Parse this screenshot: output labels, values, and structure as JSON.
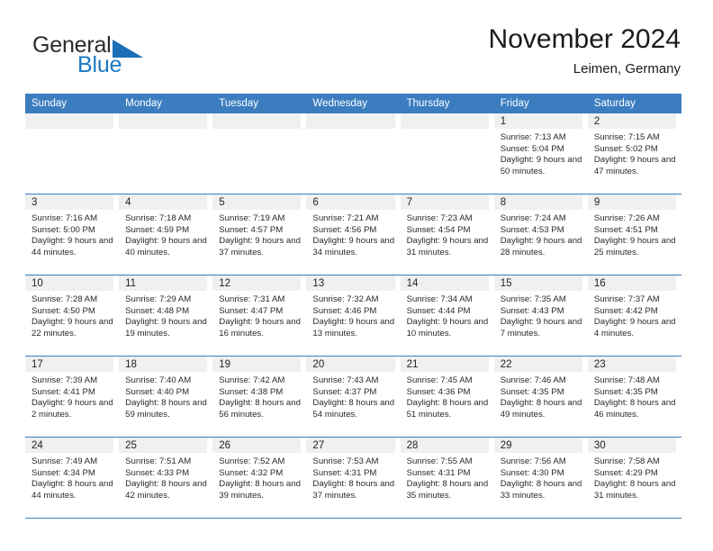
{
  "brand": {
    "name_part1": "General",
    "name_part2": "Blue",
    "accent_color": "#1b79c3",
    "triangle_color": "#1b6fb5"
  },
  "header": {
    "title": "November 2024",
    "subtitle": "Leimen, Germany"
  },
  "calendar": {
    "header_bg": "#3b7dbf",
    "band_bg": "#f0f0f0",
    "weekdays": [
      "Sunday",
      "Monday",
      "Tuesday",
      "Wednesday",
      "Thursday",
      "Friday",
      "Saturday"
    ],
    "labels": {
      "sunrise": "Sunrise:",
      "sunset": "Sunset:",
      "daylight": "Daylight:"
    },
    "weeks": [
      [
        {
          "day": "",
          "empty": true
        },
        {
          "day": "",
          "empty": true
        },
        {
          "day": "",
          "empty": true
        },
        {
          "day": "",
          "empty": true
        },
        {
          "day": "",
          "empty": true
        },
        {
          "day": "1",
          "sunrise": "Sunrise: 7:13 AM",
          "sunset": "Sunset: 5:04 PM",
          "daylight": "Daylight: 9 hours and 50 minutes."
        },
        {
          "day": "2",
          "sunrise": "Sunrise: 7:15 AM",
          "sunset": "Sunset: 5:02 PM",
          "daylight": "Daylight: 9 hours and 47 minutes."
        }
      ],
      [
        {
          "day": "3",
          "sunrise": "Sunrise: 7:16 AM",
          "sunset": "Sunset: 5:00 PM",
          "daylight": "Daylight: 9 hours and 44 minutes."
        },
        {
          "day": "4",
          "sunrise": "Sunrise: 7:18 AM",
          "sunset": "Sunset: 4:59 PM",
          "daylight": "Daylight: 9 hours and 40 minutes."
        },
        {
          "day": "5",
          "sunrise": "Sunrise: 7:19 AM",
          "sunset": "Sunset: 4:57 PM",
          "daylight": "Daylight: 9 hours and 37 minutes."
        },
        {
          "day": "6",
          "sunrise": "Sunrise: 7:21 AM",
          "sunset": "Sunset: 4:56 PM",
          "daylight": "Daylight: 9 hours and 34 minutes."
        },
        {
          "day": "7",
          "sunrise": "Sunrise: 7:23 AM",
          "sunset": "Sunset: 4:54 PM",
          "daylight": "Daylight: 9 hours and 31 minutes."
        },
        {
          "day": "8",
          "sunrise": "Sunrise: 7:24 AM",
          "sunset": "Sunset: 4:53 PM",
          "daylight": "Daylight: 9 hours and 28 minutes."
        },
        {
          "day": "9",
          "sunrise": "Sunrise: 7:26 AM",
          "sunset": "Sunset: 4:51 PM",
          "daylight": "Daylight: 9 hours and 25 minutes."
        }
      ],
      [
        {
          "day": "10",
          "sunrise": "Sunrise: 7:28 AM",
          "sunset": "Sunset: 4:50 PM",
          "daylight": "Daylight: 9 hours and 22 minutes."
        },
        {
          "day": "11",
          "sunrise": "Sunrise: 7:29 AM",
          "sunset": "Sunset: 4:48 PM",
          "daylight": "Daylight: 9 hours and 19 minutes."
        },
        {
          "day": "12",
          "sunrise": "Sunrise: 7:31 AM",
          "sunset": "Sunset: 4:47 PM",
          "daylight": "Daylight: 9 hours and 16 minutes."
        },
        {
          "day": "13",
          "sunrise": "Sunrise: 7:32 AM",
          "sunset": "Sunset: 4:46 PM",
          "daylight": "Daylight: 9 hours and 13 minutes."
        },
        {
          "day": "14",
          "sunrise": "Sunrise: 7:34 AM",
          "sunset": "Sunset: 4:44 PM",
          "daylight": "Daylight: 9 hours and 10 minutes."
        },
        {
          "day": "15",
          "sunrise": "Sunrise: 7:35 AM",
          "sunset": "Sunset: 4:43 PM",
          "daylight": "Daylight: 9 hours and 7 minutes."
        },
        {
          "day": "16",
          "sunrise": "Sunrise: 7:37 AM",
          "sunset": "Sunset: 4:42 PM",
          "daylight": "Daylight: 9 hours and 4 minutes."
        }
      ],
      [
        {
          "day": "17",
          "sunrise": "Sunrise: 7:39 AM",
          "sunset": "Sunset: 4:41 PM",
          "daylight": "Daylight: 9 hours and 2 minutes."
        },
        {
          "day": "18",
          "sunrise": "Sunrise: 7:40 AM",
          "sunset": "Sunset: 4:40 PM",
          "daylight": "Daylight: 8 hours and 59 minutes."
        },
        {
          "day": "19",
          "sunrise": "Sunrise: 7:42 AM",
          "sunset": "Sunset: 4:38 PM",
          "daylight": "Daylight: 8 hours and 56 minutes."
        },
        {
          "day": "20",
          "sunrise": "Sunrise: 7:43 AM",
          "sunset": "Sunset: 4:37 PM",
          "daylight": "Daylight: 8 hours and 54 minutes."
        },
        {
          "day": "21",
          "sunrise": "Sunrise: 7:45 AM",
          "sunset": "Sunset: 4:36 PM",
          "daylight": "Daylight: 8 hours and 51 minutes."
        },
        {
          "day": "22",
          "sunrise": "Sunrise: 7:46 AM",
          "sunset": "Sunset: 4:35 PM",
          "daylight": "Daylight: 8 hours and 49 minutes."
        },
        {
          "day": "23",
          "sunrise": "Sunrise: 7:48 AM",
          "sunset": "Sunset: 4:35 PM",
          "daylight": "Daylight: 8 hours and 46 minutes."
        }
      ],
      [
        {
          "day": "24",
          "sunrise": "Sunrise: 7:49 AM",
          "sunset": "Sunset: 4:34 PM",
          "daylight": "Daylight: 8 hours and 44 minutes."
        },
        {
          "day": "25",
          "sunrise": "Sunrise: 7:51 AM",
          "sunset": "Sunset: 4:33 PM",
          "daylight": "Daylight: 8 hours and 42 minutes."
        },
        {
          "day": "26",
          "sunrise": "Sunrise: 7:52 AM",
          "sunset": "Sunset: 4:32 PM",
          "daylight": "Daylight: 8 hours and 39 minutes."
        },
        {
          "day": "27",
          "sunrise": "Sunrise: 7:53 AM",
          "sunset": "Sunset: 4:31 PM",
          "daylight": "Daylight: 8 hours and 37 minutes."
        },
        {
          "day": "28",
          "sunrise": "Sunrise: 7:55 AM",
          "sunset": "Sunset: 4:31 PM",
          "daylight": "Daylight: 8 hours and 35 minutes."
        },
        {
          "day": "29",
          "sunrise": "Sunrise: 7:56 AM",
          "sunset": "Sunset: 4:30 PM",
          "daylight": "Daylight: 8 hours and 33 minutes."
        },
        {
          "day": "30",
          "sunrise": "Sunrise: 7:58 AM",
          "sunset": "Sunset: 4:29 PM",
          "daylight": "Daylight: 8 hours and 31 minutes."
        }
      ]
    ]
  }
}
